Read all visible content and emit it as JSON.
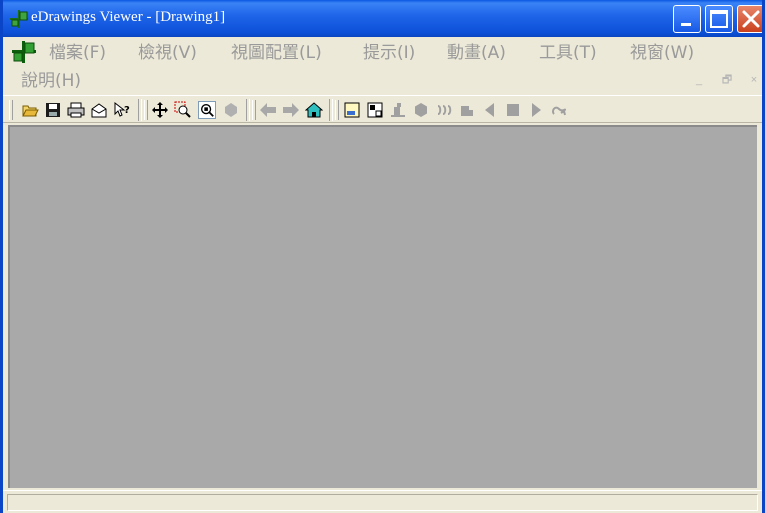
{
  "window": {
    "title": "eDrawings Viewer - [Drawing1]",
    "title_color": "#ffffff",
    "titlebar_color": "#0c50d8",
    "buttons": {
      "minimize": "minimize-icon",
      "maximize": "maximize-icon",
      "close": "close-icon"
    }
  },
  "menu": {
    "app_icon": "edrawings-icon",
    "items": [
      {
        "label": "檔案(F)"
      },
      {
        "label": "檢視(V)"
      },
      {
        "label": "視圖配置(L)"
      },
      {
        "label": "提示(I)"
      },
      {
        "label": "動畫(A)"
      },
      {
        "label": "工具(T)"
      },
      {
        "label": "視窗(W)"
      },
      {
        "label": "說明(H)"
      }
    ],
    "disabled_color": "#9a9a9a",
    "mdi_controls": {
      "minimize": "_",
      "restore": "🗗",
      "close": "×"
    }
  },
  "toolbar": {
    "groups": [
      [
        "open-icon",
        "save-icon",
        "print-icon",
        "send-icon",
        "whats-this-icon"
      ],
      [
        "pan-icon",
        "zoom-box-icon",
        "zoom-fit-icon",
        "rotate-icon"
      ],
      [
        "back-icon",
        "forward-icon",
        "home-icon"
      ],
      [
        "sheet-icon",
        "sheet-format-icon",
        "measure-icon",
        "solid-icon",
        "explode-icon",
        "section-icon",
        "prev-icon",
        "stop-icon",
        "play-icon",
        "loop-icon"
      ]
    ]
  },
  "client": {
    "background": "#a9a9a9"
  },
  "status": {
    "text": ""
  }
}
